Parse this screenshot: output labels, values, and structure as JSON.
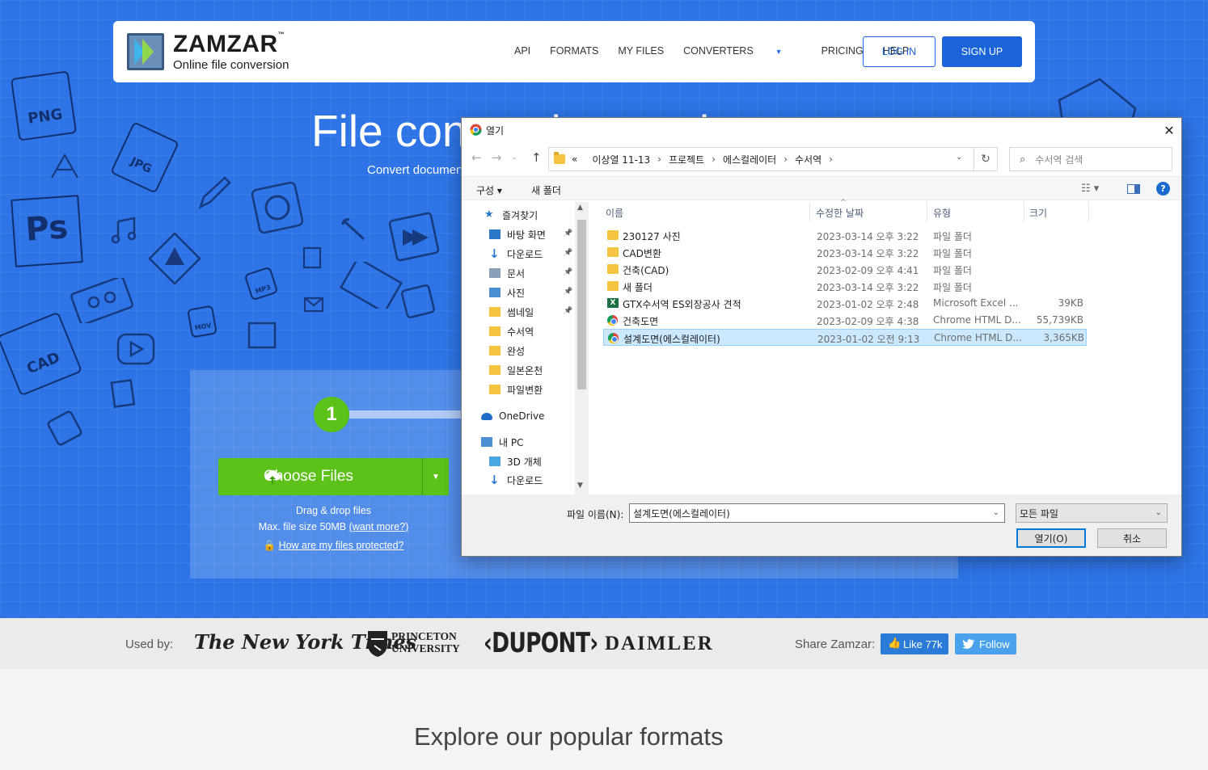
{
  "zamzar": {
    "brand": "ZAMZAR",
    "tm": "™",
    "tagline": "Online file conversion",
    "nav": [
      "API",
      "FORMATS",
      "MY FILES",
      "CONVERTERS",
      "PRICING",
      "HELP"
    ],
    "login_label": "LOG IN",
    "signup_label": "SIGN UP",
    "hero_title": "File conversion made easy",
    "hero_subtitle": "Convert documents, images, videos & sound - 1100+ formats supported",
    "step_number": "1",
    "choose_files_label": "Choose Files",
    "drag_drop": "Drag & drop files",
    "max_size_prefix": "Max. file size 50MB",
    "want_more": "(want more?)",
    "protected_link": "How are my files protected?",
    "deco_labels": [
      "PNG",
      "JPG",
      "Ps",
      "CAD",
      "MP3",
      "MOV"
    ],
    "used_by_label": "Used by:",
    "brands": {
      "nyt": "The New York Times",
      "princeton_1": "PRINCETON",
      "princeton_2": "UNIVERSITY",
      "dupont": "‹DUPONT›",
      "daimler": "DAIMLER"
    },
    "share_label": "Share Zamzar:",
    "fb_label": "Like 77k",
    "tw_label": "Follow",
    "explore_heading": "Explore our popular formats",
    "colors": {
      "hero_bg": "#2e74e6",
      "green": "#5cc21a",
      "primary": "#1a63d8"
    }
  },
  "dialog": {
    "title": "열기",
    "close": "✕",
    "breadcrumb": [
      "«",
      "이상열 11-13",
      "프로젝트",
      "에스컬레이터",
      "수서역"
    ],
    "search_placeholder": "수서역 검색",
    "toolbar": {
      "organize": "구성 ▾",
      "new_folder": "새 폴더",
      "view": "☷ ▾",
      "help": "?"
    },
    "sidebar": [
      {
        "label": "즐겨찾기",
        "icon": "star-icon"
      },
      {
        "label": "바탕 화면",
        "icon": "desktop-icon",
        "pinned": true
      },
      {
        "label": "다운로드",
        "icon": "download-icon",
        "pinned": true
      },
      {
        "label": "문서",
        "icon": "document-icon",
        "pinned": true
      },
      {
        "label": "사진",
        "icon": "pictures-icon",
        "pinned": true
      },
      {
        "label": "썸네일",
        "icon": "folder-icon",
        "pinned": true
      },
      {
        "label": "수서역",
        "icon": "folder-icon"
      },
      {
        "label": "완성",
        "icon": "folder-icon"
      },
      {
        "label": "일본온천",
        "icon": "folder-icon"
      },
      {
        "label": "파일변환",
        "icon": "folder-icon"
      },
      {
        "label": "OneDrive",
        "icon": "cloud-icon"
      },
      {
        "label": "내 PC",
        "icon": "pc-icon"
      },
      {
        "label": "3D 개체",
        "icon": "cube-icon"
      },
      {
        "label": "다운로드",
        "icon": "download-icon"
      }
    ],
    "columns": [
      "이름",
      "수정한 날짜",
      "유형",
      "크기"
    ],
    "files": [
      {
        "name": "230127 사진",
        "date": "2023-03-14 오후 3:22",
        "type": "파일 폴더",
        "size": "",
        "icon": "folder-icon"
      },
      {
        "name": "CAD변환",
        "date": "2023-03-14 오후 3:22",
        "type": "파일 폴더",
        "size": "",
        "icon": "folder-icon"
      },
      {
        "name": "건축(CAD)",
        "date": "2023-02-09 오후 4:41",
        "type": "파일 폴더",
        "size": "",
        "icon": "folder-icon"
      },
      {
        "name": "새 폴더",
        "date": "2023-03-14 오후 3:22",
        "type": "파일 폴더",
        "size": "",
        "icon": "folder-icon"
      },
      {
        "name": "GTX수서역 ES외장공사 견적",
        "date": "2023-01-02 오후 2:48",
        "type": "Microsoft Excel ...",
        "size": "39KB",
        "icon": "excel-icon"
      },
      {
        "name": "건축도면",
        "date": "2023-02-09 오후 4:38",
        "type": "Chrome HTML D...",
        "size": "55,739KB",
        "icon": "chrome-icon"
      },
      {
        "name": "설계도면(에스컬레이터)",
        "date": "2023-01-02 오전 9:13",
        "type": "Chrome HTML D...",
        "size": "3,365KB",
        "icon": "chrome-icon",
        "selected": true
      }
    ],
    "filename_label": "파일 이름(N):",
    "filename_value": "설계도면(에스컬레이터)",
    "filetype_value": "모든 파일",
    "open_label": "열기(O)",
    "cancel_label": "취소"
  }
}
